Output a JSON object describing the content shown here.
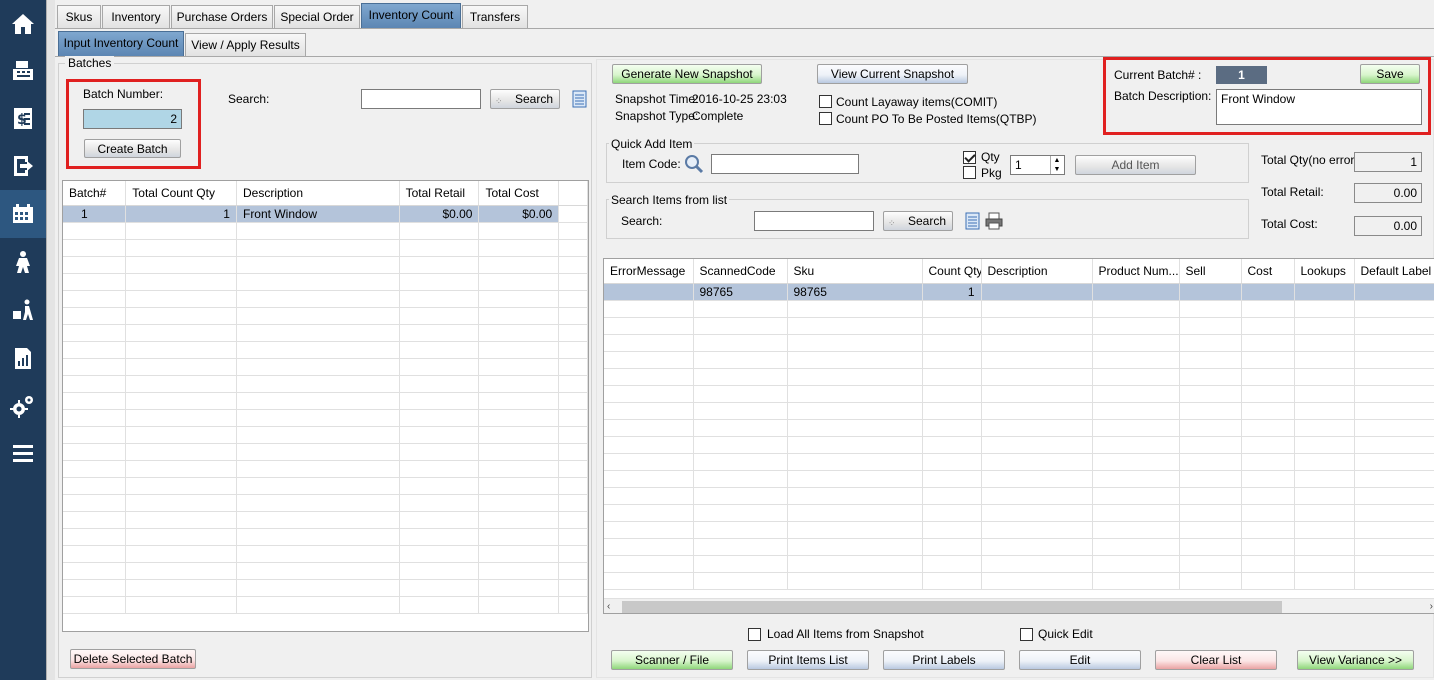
{
  "top_tabs": [
    "Skus",
    "Inventory",
    "Purchase Orders",
    "Special Order",
    "Inventory Count",
    "Transfers"
  ],
  "active_top_tab": "Inventory Count",
  "sub_tabs": [
    "Input Inventory Count",
    "View / Apply Results"
  ],
  "active_sub_tab": "Input Inventory Count",
  "nav_icons": [
    "home-icon",
    "register-icon",
    "invoice-icon",
    "exit-icon",
    "calendar-icon",
    "customers-icon",
    "delivery-icon",
    "report-icon",
    "settings-icon",
    "menu-icon"
  ],
  "batches": {
    "group_title": "Batches",
    "batch_number_label": "Batch Number:",
    "batch_number_value": "2",
    "create_batch_label": "Create Batch",
    "search_label": "Search:",
    "search_value": "",
    "search_button": "Search",
    "columns": [
      "Batch#",
      "Total Count Qty",
      "Description",
      "Total Retail",
      "Total Cost"
    ],
    "rows": [
      [
        "1",
        "1",
        "Front Window",
        "$0.00",
        "$0.00"
      ]
    ],
    "delete_button": "Delete Selected Batch"
  },
  "snapshot": {
    "generate_button": "Generate New Snapshot",
    "view_button": "View Current Snapshot",
    "time_label": "Snapshot Time:",
    "time_value": "2016-10-25 23:03",
    "type_label": "Snapshot Type:",
    "type_value": "Complete",
    "count_layaway_label": "Count Layaway items(COMIT)",
    "count_po_label": "Count PO To Be Posted Items(QTBP)"
  },
  "current_batch": {
    "label": "Current Batch# :",
    "value": "1",
    "save_button": "Save",
    "description_label": "Batch Description:",
    "description_value": "Front Window"
  },
  "quick_add": {
    "group_title": "Quick Add Item",
    "item_code_label": "Item Code:",
    "item_code_value": "",
    "qty_label": "Qty",
    "pkg_label": "Pkg",
    "qty_value": "1",
    "add_button": "Add Item"
  },
  "search_items": {
    "group_title": "Search Items from list",
    "search_label": "Search:",
    "search_value": "",
    "search_button": "Search"
  },
  "totals": {
    "qty_label": "Total Qty(no error):",
    "qty_value": "1",
    "retail_label": "Total Retail:",
    "retail_value": "0.00",
    "cost_label": "Total Cost:",
    "cost_value": "0.00"
  },
  "items_grid": {
    "columns": [
      "ErrorMessage",
      "ScannedCode",
      "Sku",
      "Count Qty",
      "Description",
      "Product Num...",
      "Sell",
      "Cost",
      "Lookups",
      "Default Label T"
    ],
    "rows": [
      [
        "",
        "98765",
        "98765",
        "1",
        "",
        "",
        "",
        "",
        "",
        ""
      ]
    ]
  },
  "bottom": {
    "load_all_label": "Load All Items from Snapshot",
    "quick_edit_label": "Quick Edit",
    "buttons": [
      "Scanner / File",
      "Print Items List",
      "Print Labels",
      "Edit",
      "Clear List",
      "View Variance >>"
    ]
  }
}
